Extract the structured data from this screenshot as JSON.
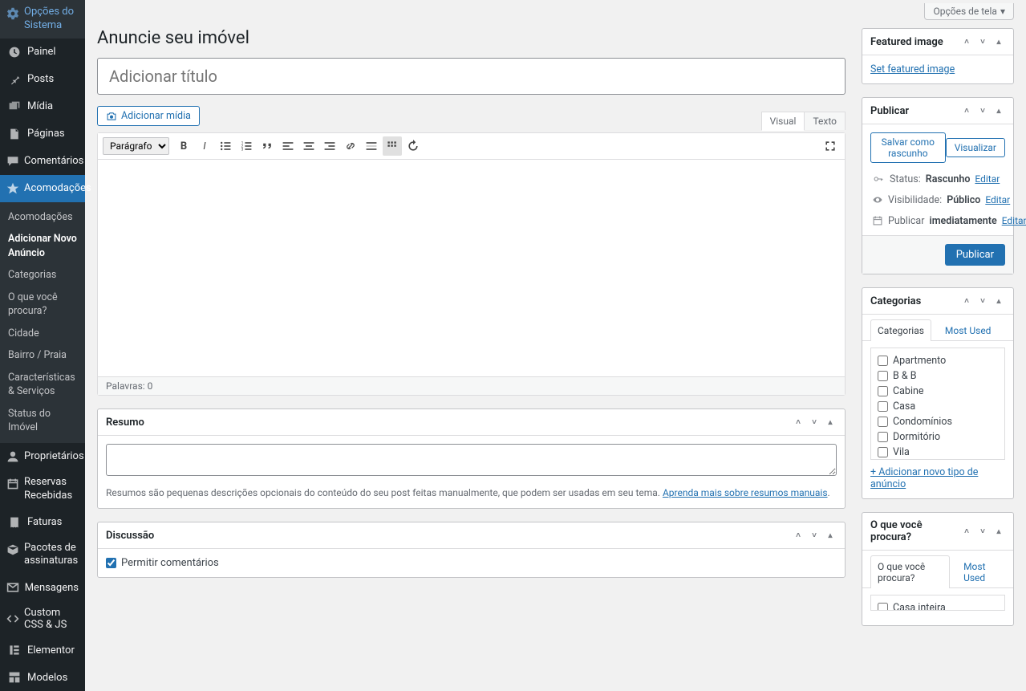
{
  "screen_options": "Opções de tela",
  "sidebar": {
    "items": [
      {
        "label": "Opções do Sistema"
      },
      {
        "label": "Painel"
      },
      {
        "label": "Posts"
      },
      {
        "label": "Mídia"
      },
      {
        "label": "Páginas"
      },
      {
        "label": "Comentários"
      },
      {
        "label": "Acomodações"
      },
      {
        "label": "Proprietários"
      },
      {
        "label": "Reservas Recebidas"
      },
      {
        "label": "Faturas"
      },
      {
        "label": "Pacotes de assinaturas"
      },
      {
        "label": "Mensagens"
      },
      {
        "label": "Custom CSS & JS"
      },
      {
        "label": "Elementor"
      },
      {
        "label": "Modelos"
      }
    ],
    "submenu": [
      {
        "label": "Acomodações"
      },
      {
        "label": "Adicionar Novo Anúncio"
      },
      {
        "label": "Categorias"
      },
      {
        "label": "O que você procura?"
      },
      {
        "label": "Cidade"
      },
      {
        "label": "Bairro / Praia"
      },
      {
        "label": "Características & Serviços"
      },
      {
        "label": "Status do Imóvel"
      }
    ]
  },
  "page": {
    "title": "Anuncie seu imóvel",
    "title_placeholder": "Adicionar título"
  },
  "media_btn": "Adicionar mídia",
  "editor": {
    "tab_visual": "Visual",
    "tab_text": "Texto",
    "format_select": "Parágrafo",
    "word_count_label": "Palavras:",
    "word_count": "0"
  },
  "excerpt": {
    "heading": "Resumo",
    "help": "Resumos são pequenas descrições opcionais do conteúdo do seu post feitas manualmente, que podem ser usadas em seu tema.",
    "help_link": "Aprenda mais sobre resumos manuais"
  },
  "discussion": {
    "heading": "Discussão",
    "allow_comments": "Permitir comentários"
  },
  "featured": {
    "heading": "Featured image",
    "link": "Set featured image"
  },
  "publish": {
    "heading": "Publicar",
    "save_draft": "Salvar como rascunho",
    "preview": "Visualizar",
    "status_label": "Status:",
    "status_value": "Rascunho",
    "visibility_label": "Visibilidade:",
    "visibility_value": "Público",
    "schedule_label": "Publicar",
    "schedule_value": "imediatamente",
    "edit": "Editar",
    "button": "Publicar"
  },
  "categories": {
    "heading": "Categorias",
    "tab_all": "Categorias",
    "tab_most": "Most Used",
    "items": [
      "Apartmento",
      "B & B",
      "Cabine",
      "Casa",
      "Condomínios",
      "Dormitório",
      "Vila"
    ],
    "add_new": "+ Adicionar novo tipo de anúncio"
  },
  "looking_for": {
    "heading": "O que você procura?",
    "tab_all": "O que você procura?",
    "tab_most": "Most Used",
    "item": "Casa inteira"
  }
}
